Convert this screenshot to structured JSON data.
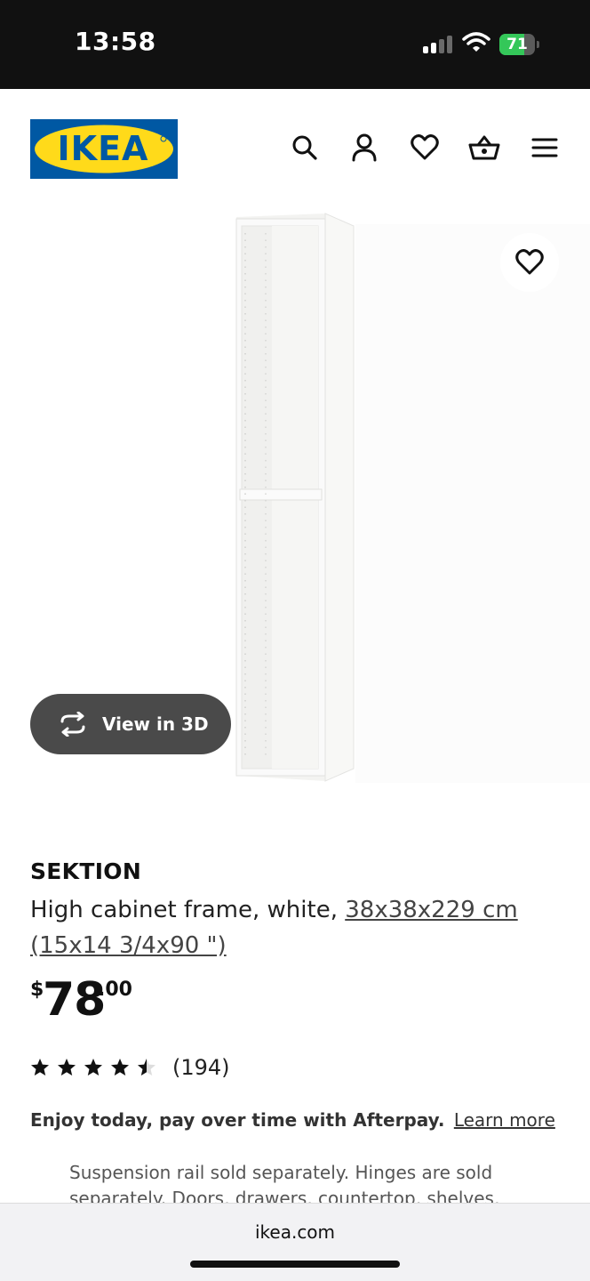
{
  "status_bar": {
    "time": "13:58",
    "battery": "71",
    "battery_level": 0.71,
    "battery_color": "#34c759"
  },
  "header": {
    "logo_text": "IKEA",
    "brand_blue": "#0058a3",
    "brand_yellow": "#ffda1a",
    "icons": [
      "search-icon",
      "account-icon",
      "heart-icon",
      "basket-icon",
      "menu-icon"
    ]
  },
  "product_image": {
    "favorite_icon": "heart-icon",
    "view_3d_label": "View in 3D",
    "view_3d_icon": "rotate-icon"
  },
  "product": {
    "name": "SEKTION",
    "description": "High cabinet frame, white, ",
    "measurement_line1": "38x38x229 cm",
    "measurement_line2": "(15x14 3/4x90 \")",
    "price_currency": "$",
    "price_integer": "78",
    "price_decimal": ".00",
    "rating_value": 4.5,
    "rating_max": 5,
    "rating_count": "(194)",
    "afterpay_text": "Enjoy today, pay over time with Afterpay.",
    "afterpay_link": "Learn more",
    "notice": "Suspension rail sold separately. Hinges are sold separately. Doors, drawers, countertop, shelves, hinges"
  },
  "browser": {
    "url": "ikea.com"
  }
}
